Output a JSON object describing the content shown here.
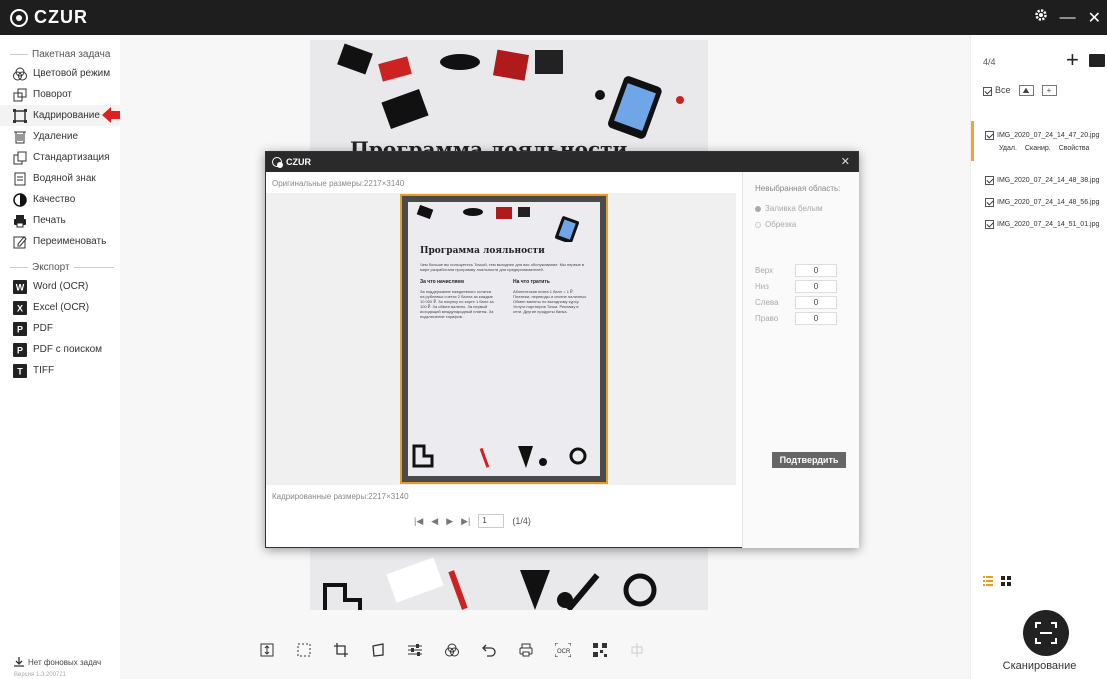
{
  "app": {
    "brand": "CZUR"
  },
  "sidebar": {
    "batch_title": "Пакетная задача",
    "items": [
      {
        "label": "Цветовой режим",
        "icon": "color-mode-icon"
      },
      {
        "label": "Поворот",
        "icon": "rotate-icon"
      },
      {
        "label": "Кадрирование",
        "icon": "crop-icon",
        "active": true
      },
      {
        "label": "Удаление",
        "icon": "delete-icon"
      },
      {
        "label": "Стандартизация",
        "icon": "standardize-icon"
      },
      {
        "label": "Водяной знак",
        "icon": "watermark-icon"
      },
      {
        "label": "Качество",
        "icon": "quality-icon"
      },
      {
        "label": "Печать",
        "icon": "print-icon"
      },
      {
        "label": "Переименовать",
        "icon": "rename-icon"
      }
    ],
    "export_title": "Экспорт",
    "export_items": [
      {
        "label": "Word (OCR)",
        "badge": "W"
      },
      {
        "label": "Excel (OCR)",
        "badge": "X"
      },
      {
        "label": "PDF",
        "badge": "P"
      },
      {
        "label": "PDF с поиском",
        "badge": "P"
      },
      {
        "label": "TIFF",
        "badge": "T"
      }
    ],
    "footer": "Нет фоновых задач",
    "version": "Версия 1.3.200721"
  },
  "document": {
    "title": "Программа лояльности"
  },
  "dialog": {
    "brand": "CZUR",
    "original_size": "Оригинальные размеры:2217×3140",
    "cropped_size": "Кадрированные размеры:2217×3140",
    "pager": {
      "page": "1",
      "total": "(1/4)"
    },
    "side_title": "Невыбранная область:",
    "fill_white": "Заливка белым",
    "crop_option": "Обрезка",
    "margins": [
      {
        "label": "Верх",
        "value": "0"
      },
      {
        "label": "Низ",
        "value": "0"
      },
      {
        "label": "Слева",
        "value": "0"
      },
      {
        "label": "Право",
        "value": "0"
      }
    ],
    "confirm": "Подтвердить",
    "preview_doc": {
      "title": "Программа лояльности",
      "intro": "Чем больше вы пользуетесь Точкой, тем выгоднее для вас обслуживание. Мы первые в мире разработали программу лояльности для предпринимателей.",
      "col1_title": "За что начисляем",
      "col1_text": "За поддержание ежедневного остатка на рублевых счетах 2 балла за каждые 10 000 ₽. За покупку по карте 1 балл за 100 ₽. За обмен валюты. За первый исходящий международный платеж. За подключение тарифов.",
      "col2_title": "На что тратить",
      "col2_text": "Абонентская плата 1 балл = 1 ₽. Платежи, переводы и снятие наличных. Обмен валюты по выгодному курсу. Услуги партнеров Точки. Рекламу в сети. Другие продукты банка."
    }
  },
  "right_panel": {
    "count": "4/4",
    "all_label": "Все",
    "files": [
      {
        "name": "IMG_2020_07_24_14_47_20.jpg",
        "active": true
      },
      {
        "name": "IMG_2020_07_24_14_48_38.jpg"
      },
      {
        "name": "IMG_2020_07_24_14_48_56.jpg"
      },
      {
        "name": "IMG_2020_07_24_14_51_01.jpg"
      }
    ],
    "actions": [
      "Удал.",
      "Сканир.",
      "Свойства"
    ],
    "scan_label": "Сканирование"
  },
  "colors": {
    "accent": "#e49d2a",
    "arrow": "#e02020",
    "titlebar": "#1e1e1e"
  }
}
